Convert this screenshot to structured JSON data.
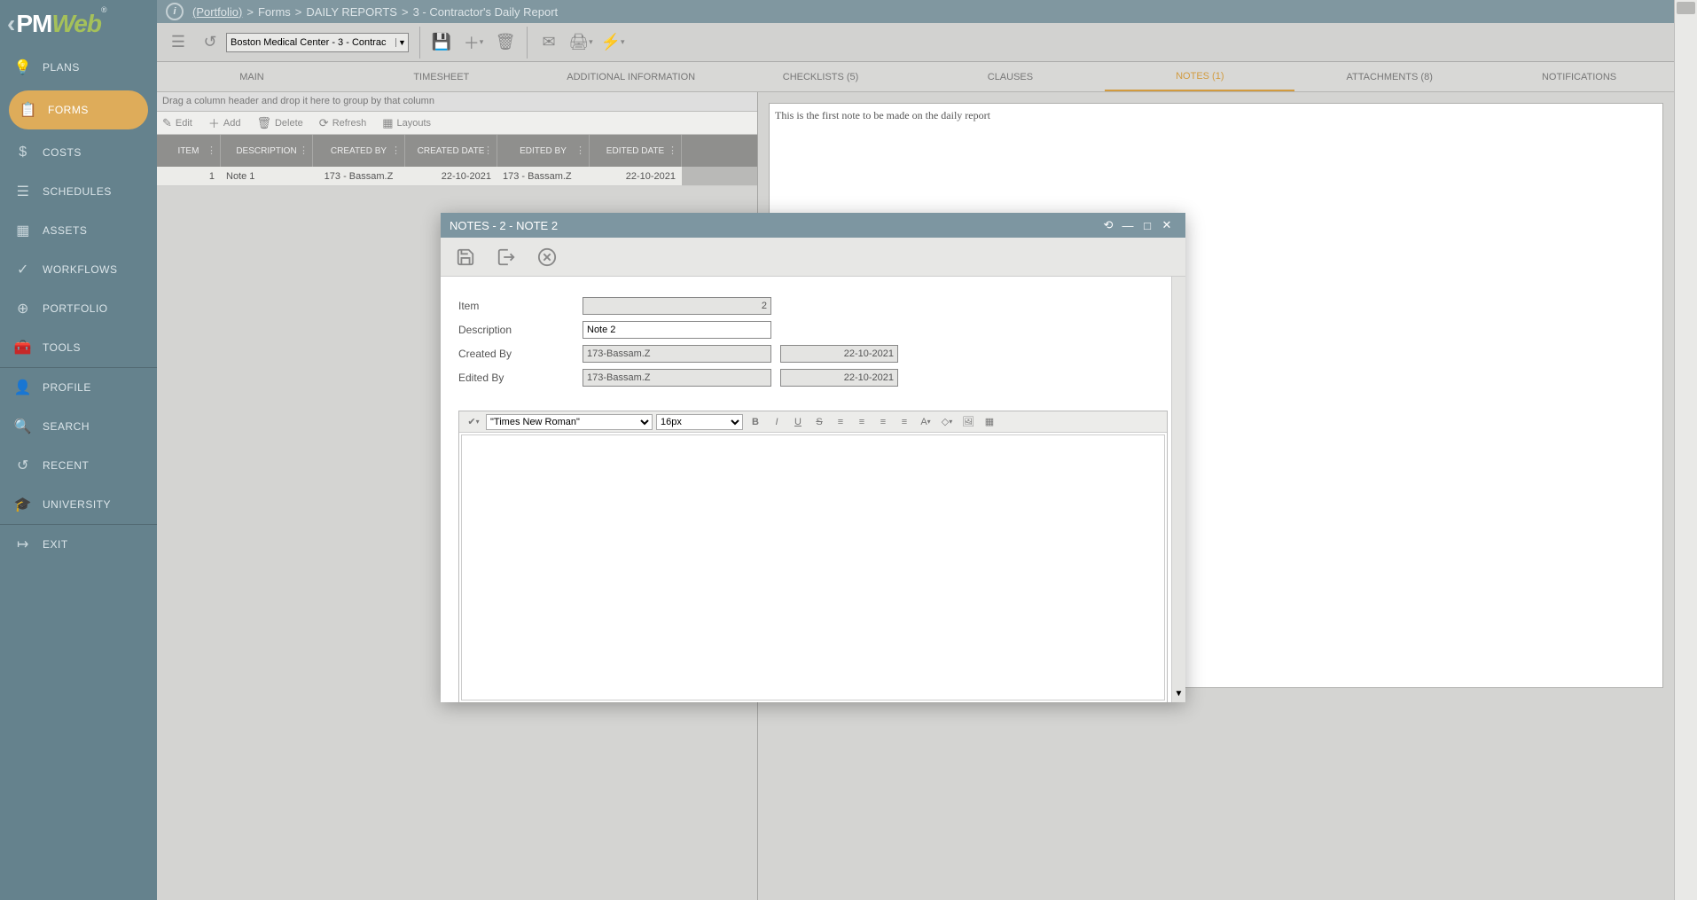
{
  "logo": {
    "pm": "PM",
    "web": "Web"
  },
  "breadcrumb": {
    "portfolio": "(Portfolio)",
    "forms": "Forms",
    "daily": "DAILY REPORTS",
    "record": "3 - Contractor's Daily Report",
    "sep": ">"
  },
  "sidebar": [
    {
      "label": "PLANS",
      "icon": "💡"
    },
    {
      "label": "FORMS",
      "icon": "📋",
      "active": true
    },
    {
      "label": "COSTS",
      "icon": "$"
    },
    {
      "label": "SCHEDULES",
      "icon": "☰"
    },
    {
      "label": "ASSETS",
      "icon": "▦"
    },
    {
      "label": "WORKFLOWS",
      "icon": "✓"
    },
    {
      "label": "PORTFOLIO",
      "icon": "⊕"
    },
    {
      "label": "TOOLS",
      "icon": "🧰"
    }
  ],
  "sidebar2": [
    {
      "label": "PROFILE",
      "icon": "👤"
    },
    {
      "label": "SEARCH",
      "icon": "🔍"
    },
    {
      "label": "RECENT",
      "icon": "↺"
    },
    {
      "label": "UNIVERSITY",
      "icon": "🎓"
    }
  ],
  "sidebar3": [
    {
      "label": "EXIT",
      "icon": "↦"
    }
  ],
  "picker": "Boston Medical Center - 3 - Contrac",
  "tabs": [
    {
      "label": "MAIN"
    },
    {
      "label": "TIMESHEET"
    },
    {
      "label": "ADDITIONAL INFORMATION"
    },
    {
      "label": "CHECKLISTS (5)"
    },
    {
      "label": "CLAUSES"
    },
    {
      "label": "NOTES (1)",
      "active": true
    },
    {
      "label": "ATTACHMENTS (8)"
    },
    {
      "label": "NOTIFICATIONS"
    }
  ],
  "grid": {
    "group_hint": "Drag a column header and drop it here to group by that column",
    "toolbar": {
      "edit": "Edit",
      "add": "Add",
      "delete": "Delete",
      "refresh": "Refresh",
      "layouts": "Layouts"
    },
    "headers": {
      "item": "ITEM",
      "description": "DESCRIPTION",
      "created_by": "CREATED BY",
      "created_date": "CREATED DATE",
      "edited_by": "EDITED BY",
      "edited_date": "EDITED DATE"
    },
    "row": {
      "item": "1",
      "description": "Note 1",
      "created_by": "173 - Bassam.Z",
      "created_date": "22-10-2021",
      "edited_by": "173 - Bassam.Z",
      "edited_date": "22-10-2021"
    }
  },
  "note_preview": "This is the first note to be made on the daily report",
  "modal": {
    "title": "NOTES - 2 - NOTE 2",
    "labels": {
      "item": "Item",
      "description": "Description",
      "created_by": "Created By",
      "edited_by": "Edited By"
    },
    "values": {
      "item": "2",
      "description": "Note 2",
      "created_by": "173-Bassam.Z",
      "created_date": "22-10-2021",
      "edited_by": "173-Bassam.Z",
      "edited_date": "22-10-2021"
    },
    "editor": {
      "font": "\"Times New Roman\"",
      "size": "16px"
    }
  }
}
